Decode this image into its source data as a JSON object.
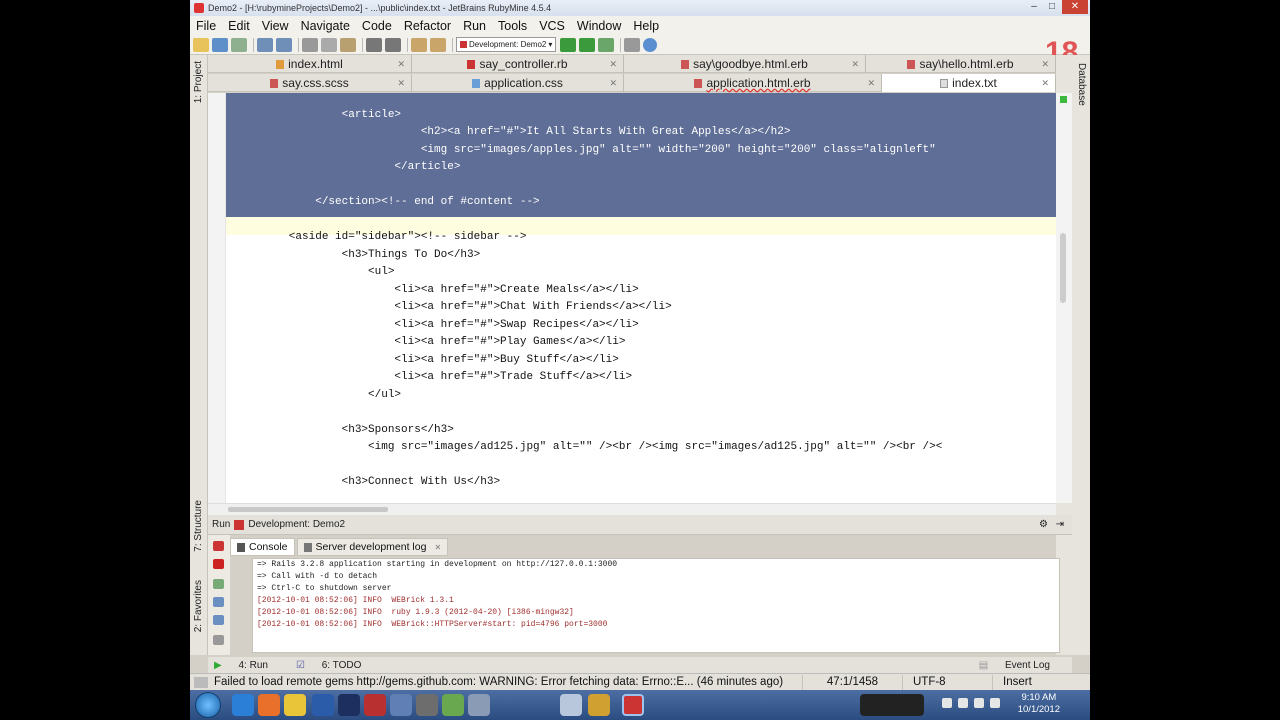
{
  "window": {
    "title": "Demo2 - [H:\\rubymineProjects\\Demo2] - ...\\public\\index.txt - JetBrains RubyMine 4.5.4",
    "controls": [
      "–",
      "□",
      "✕"
    ]
  },
  "menu": [
    "File",
    "Edit",
    "View",
    "Navigate",
    "Code",
    "Refactor",
    "Run",
    "Tools",
    "VCS",
    "Window",
    "Help"
  ],
  "toolbar": {
    "run_config": "Development: Demo2"
  },
  "badge": "18",
  "tabs_row1": [
    "index.html",
    "say_controller.rb",
    "say\\goodbye.html.erb",
    "say\\hello.html.erb"
  ],
  "tabs_row2": [
    "say.css.scss",
    "application.css",
    "application.html.erb",
    "index.txt"
  ],
  "left_panel": {
    "project": "1: Project",
    "structure": "7: Structure",
    "favorites": "2: Favorites"
  },
  "right_panel": {
    "database": "Database"
  },
  "code_lines": [
    "",
    "                <article>",
    "                            <h2><a href=\"#\">It All Starts With Great Apples</a></h2>",
    "                            <img src=\"images/apples.jpg\" alt=\"\" width=\"200\" height=\"200\" class=\"alignleft\"",
    "                        </article>",
    "",
    "            </section><!-- end of #content -->",
    "",
    "        <aside id=\"sidebar\"><!-- sidebar -->",
    "                <h3>Things To Do</h3>",
    "                    <ul>",
    "                        <li><a href=\"#\">Create Meals</a></li>",
    "                        <li><a href=\"#\">Chat With Friends</a></li>",
    "                        <li><a href=\"#\">Swap Recipes</a></li>",
    "                        <li><a href=\"#\">Play Games</a></li>",
    "                        <li><a href=\"#\">Buy Stuff</a></li>",
    "                        <li><a href=\"#\">Trade Stuff</a></li>",
    "                    </ul>",
    "",
    "                <h3>Sponsors</h3>",
    "                    <img src=\"images/ad125.jpg\" alt=\"\" /><br /><img src=\"images/ad125.jpg\" alt=\"\" /><br /><",
    "",
    "                <h3>Connect With Us</h3>"
  ],
  "run_panel": {
    "label": "Run",
    "config": "Development: Demo2",
    "tabs": [
      "Console",
      "Server development log"
    ]
  },
  "console_lines": [
    {
      "text": "=> Rails 3.2.8 application starting in development on http://127.0.0.1:3000",
      "kind": "norm"
    },
    {
      "text": "=> Call with -d to detach",
      "kind": "norm"
    },
    {
      "text": "=> Ctrl-C to shutdown server",
      "kind": "norm"
    },
    {
      "text": "[2012-10-01 08:52:06] INFO  WEBrick 1.3.1",
      "kind": "info"
    },
    {
      "text": "[2012-10-01 08:52:06] INFO  ruby 1.9.3 (2012-04-20) [i386-mingw32]",
      "kind": "info"
    },
    {
      "text": "[2012-10-01 08:52:06] INFO  WEBrick::HTTPServer#start: pid=4796 port=3000",
      "kind": "info"
    }
  ],
  "bottom_tools": {
    "run": "4: Run",
    "todo": "6: TODO",
    "event_log": "Event Log"
  },
  "status": {
    "message": "Failed to load remote gems http://gems.github.com: WARNING:  Error fetching data: Errno::E... (46 minutes ago)",
    "position": "47:1/1458",
    "encoding": "UTF-8",
    "mode": "Insert"
  },
  "taskbar": {
    "time": "9:10 AM",
    "date": "10/1/2012"
  }
}
